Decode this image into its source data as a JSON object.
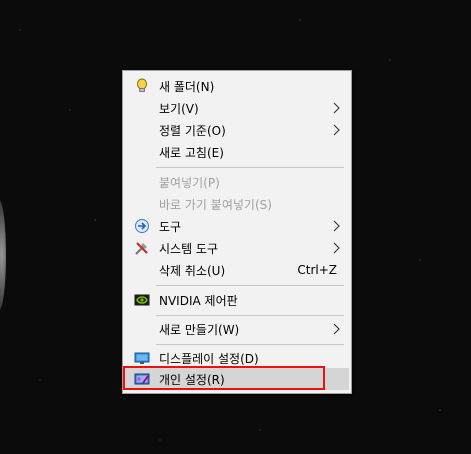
{
  "menu": {
    "items": [
      {
        "label": "새 폴더(N)",
        "icon": "bulb-icon"
      },
      {
        "label": "보기(V)",
        "submenu": true
      },
      {
        "label": "정렬 기준(O)",
        "submenu": true
      },
      {
        "label": "새로 고침(E)"
      },
      {
        "label": "붙여넣기(P)",
        "disabled": true
      },
      {
        "label": "바로 가기 붙여넣기(S)",
        "disabled": true
      },
      {
        "label": "도구",
        "icon": "arrow-right-icon",
        "submenu": true
      },
      {
        "label": "시스템 도구",
        "icon": "tools-icon",
        "submenu": true
      },
      {
        "label": "삭제 취소(U)",
        "shortcut": "Ctrl+Z"
      },
      {
        "label": "NVIDIA 제어판",
        "icon": "nvidia-icon"
      },
      {
        "label": "새로 만들기(W)",
        "submenu": true
      },
      {
        "label": "디스플레이 설정(D)",
        "icon": "display-icon"
      },
      {
        "label": "개인 설정(R)",
        "icon": "personalize-icon"
      }
    ]
  },
  "colors": {
    "menu_bg": "#f2f2f2",
    "disabled_text": "#a0a0a0",
    "highlight_border": "#e11111",
    "hover_bg": "#d5d5d5"
  }
}
